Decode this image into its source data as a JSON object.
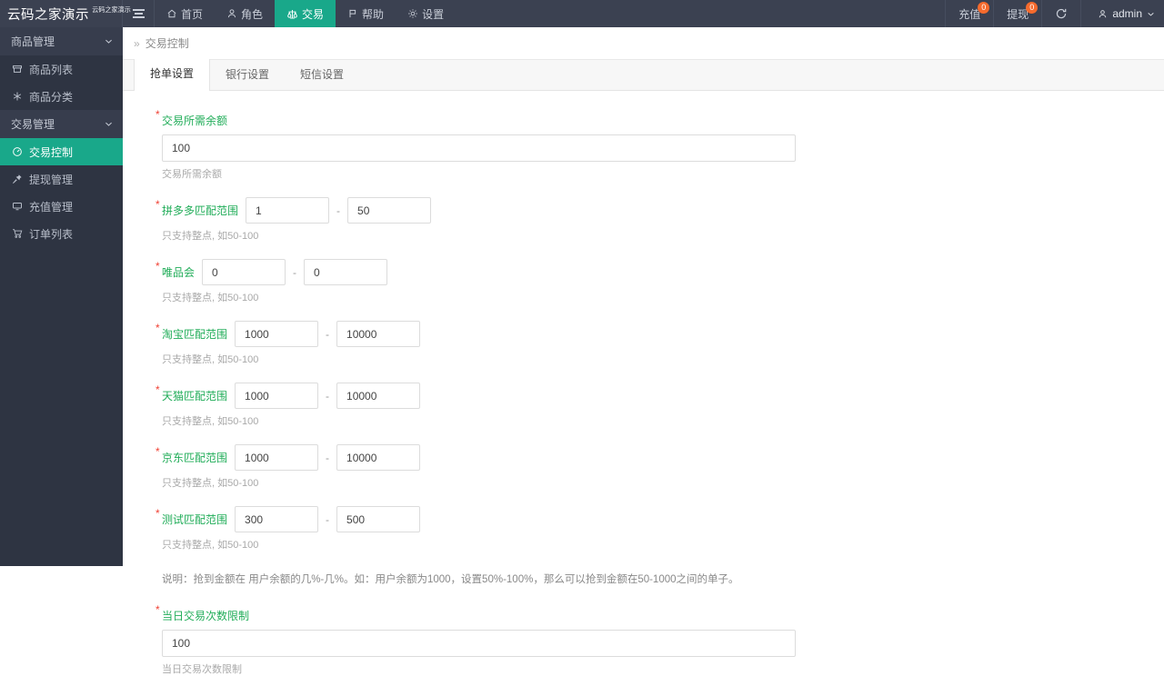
{
  "header": {
    "logo_main": "云码之家演示",
    "logo_sup": "云码之家演示",
    "menu_toggle": "menu",
    "nav": [
      {
        "label": "首页",
        "icon": "home-icon",
        "active": false
      },
      {
        "label": "角色",
        "icon": "user-icon",
        "active": false
      },
      {
        "label": "交易",
        "icon": "scale-icon",
        "active": true
      },
      {
        "label": "帮助",
        "icon": "flag-icon",
        "active": false
      },
      {
        "label": "设置",
        "icon": "gear-icon",
        "active": false
      }
    ],
    "recharge_label": "充值",
    "recharge_badge": "0",
    "withdraw_label": "提现",
    "withdraw_badge": "0",
    "refresh_icon": "refresh-icon",
    "user_name": "admin"
  },
  "sidebar": {
    "groups": [
      {
        "title": "商品管理",
        "items": [
          {
            "label": "商品列表",
            "icon": "cart-icon",
            "active": false
          },
          {
            "label": "商品分类",
            "icon": "asterisk-icon",
            "active": false
          }
        ]
      },
      {
        "title": "交易管理",
        "items": [
          {
            "label": "交易控制",
            "icon": "gauge-icon",
            "active": true
          },
          {
            "label": "提现管理",
            "icon": "pin-icon",
            "active": false
          },
          {
            "label": "充值管理",
            "icon": "monitor-icon",
            "active": false
          },
          {
            "label": "订单列表",
            "icon": "shopping-cart-icon",
            "active": false
          }
        ]
      }
    ]
  },
  "breadcrumb": {
    "separator": "»",
    "current": "交易控制"
  },
  "tabs": [
    {
      "label": "抢单设置",
      "active": true
    },
    {
      "label": "银行设置",
      "active": false
    },
    {
      "label": "短信设置",
      "active": false
    }
  ],
  "form": {
    "balance": {
      "label": "交易所需余额",
      "value": "100",
      "help": "交易所需余额"
    },
    "ranges": [
      {
        "label": "拼多多匹配范围",
        "min": "1",
        "max": "50",
        "help": "只支持整点, 如50-100",
        "dash": "-"
      },
      {
        "label": "唯品会",
        "min": "0",
        "max": "0",
        "help": "只支持整点, 如50-100",
        "dash": "-"
      },
      {
        "label": "淘宝匹配范围",
        "min": "1000",
        "max": "10000",
        "help": "只支持整点, 如50-100",
        "dash": "-"
      },
      {
        "label": "天猫匹配范围",
        "min": "1000",
        "max": "10000",
        "help": "只支持整点, 如50-100",
        "dash": "-"
      },
      {
        "label": "京东匹配范围",
        "min": "1000",
        "max": "10000",
        "help": "只支持整点, 如50-100",
        "dash": "-"
      },
      {
        "label": "测试匹配范围",
        "min": "300",
        "max": "500",
        "help": "只支持整点, 如50-100",
        "dash": "-"
      }
    ],
    "note": "说明：抢到金额在 用户余额的几%-几%。如：用户余额为1000，设置50%-100%，那么可以抢到金额在50-1000之间的单子。",
    "daily_limit": {
      "label": "当日交易次数限制",
      "value": "100",
      "help": "当日交易次数限制"
    },
    "required_mark": "*"
  },
  "colors": {
    "accent": "#19a88a",
    "header_bg": "#3b4151",
    "sidebar_bg": "#2e3442",
    "label_green": "#21ad59",
    "required_red": "#f04134",
    "badge_orange": "#f56a2d"
  }
}
